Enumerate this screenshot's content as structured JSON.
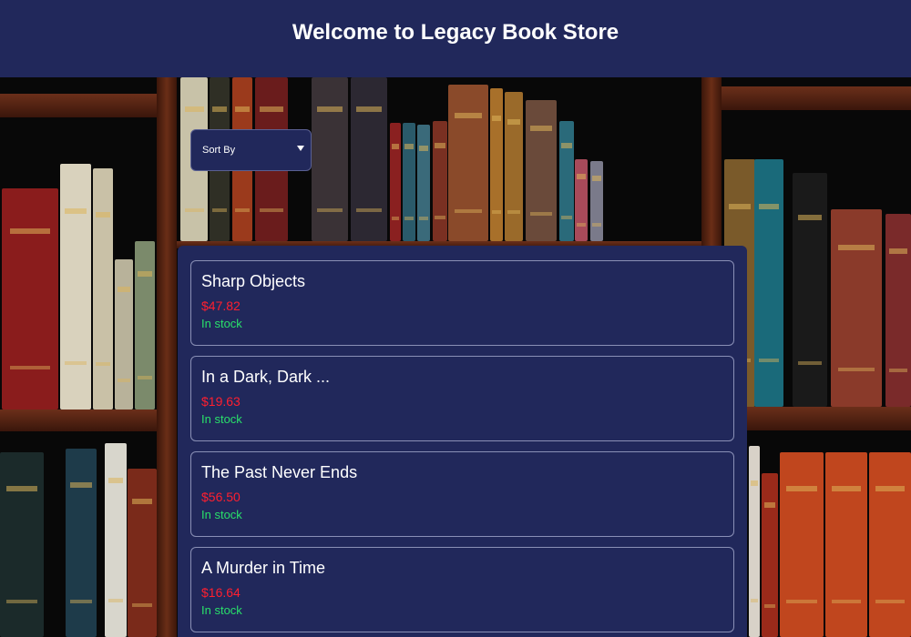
{
  "header": {
    "title": "Welcome to Legacy Book Store"
  },
  "sort": {
    "selected": "Sort By",
    "options": [
      "Sort By"
    ]
  },
  "books": [
    {
      "title": "Sharp Objects",
      "price": "$47.82",
      "stock": "In stock"
    },
    {
      "title": "In a Dark, Dark ...",
      "price": "$19.63",
      "stock": "In stock"
    },
    {
      "title": "The Past Never Ends",
      "price": "$56.50",
      "stock": "In stock"
    },
    {
      "title": "A Murder in Time",
      "price": "$16.64",
      "stock": "In stock"
    }
  ],
  "colors": {
    "header_bg": "#21285b",
    "panel_bg": "#21285b",
    "price": "#ff1f2f",
    "stock": "#29e06a"
  }
}
